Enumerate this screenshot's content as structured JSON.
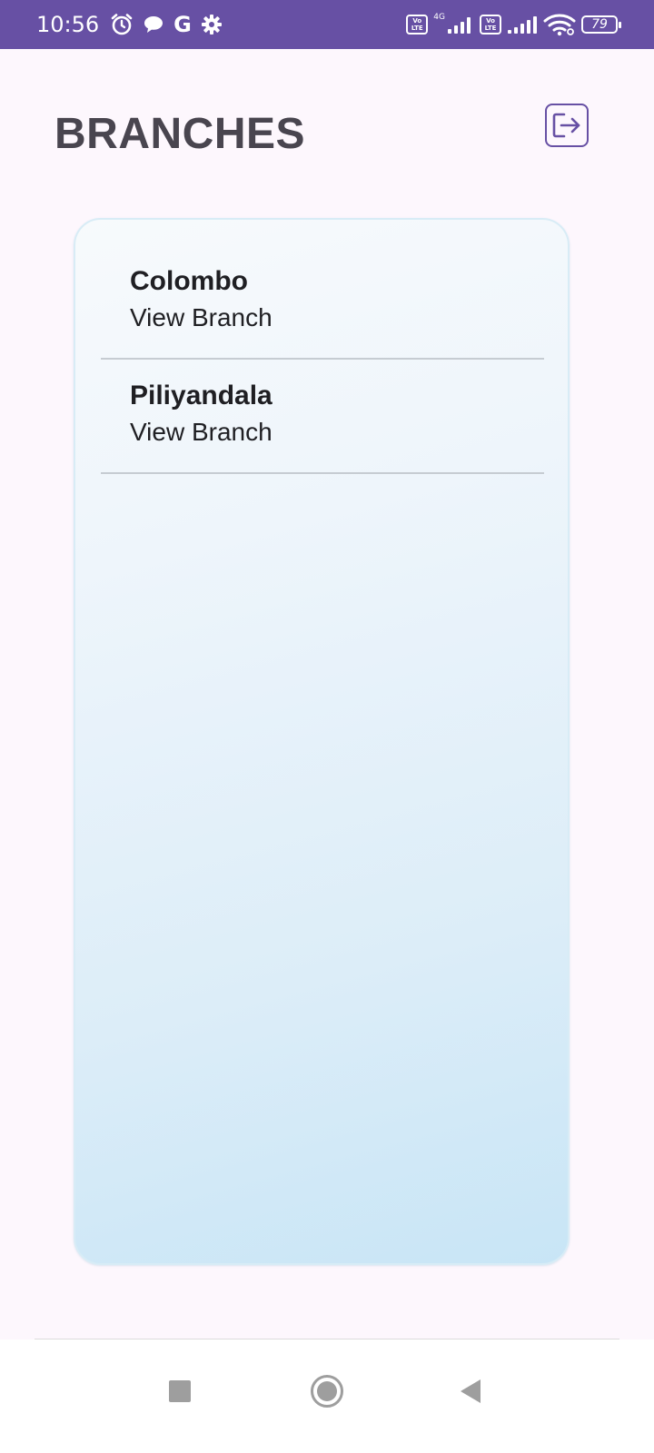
{
  "status_bar": {
    "time": "10:56",
    "battery": "79",
    "network_label": "4G",
    "lte_label": "Vo LTE",
    "icons": [
      "alarm-icon",
      "chat-icon",
      "google-icon",
      "settings-icon",
      "volte-icon",
      "signal-icon",
      "wifi-icon",
      "battery-icon"
    ]
  },
  "header": {
    "title": "BRANCHES",
    "logout_icon": "logout-icon"
  },
  "branches": [
    {
      "name": "Colombo",
      "action": "View Branch"
    },
    {
      "name": "Piliyandala",
      "action": "View Branch"
    }
  ],
  "colors": {
    "accent": "#6750a4",
    "background": "#fdf7fd",
    "title": "#49454f",
    "card_border": "#d8ecf6"
  },
  "navigation": {
    "buttons": [
      "recent-apps-icon",
      "home-icon",
      "back-icon"
    ]
  }
}
